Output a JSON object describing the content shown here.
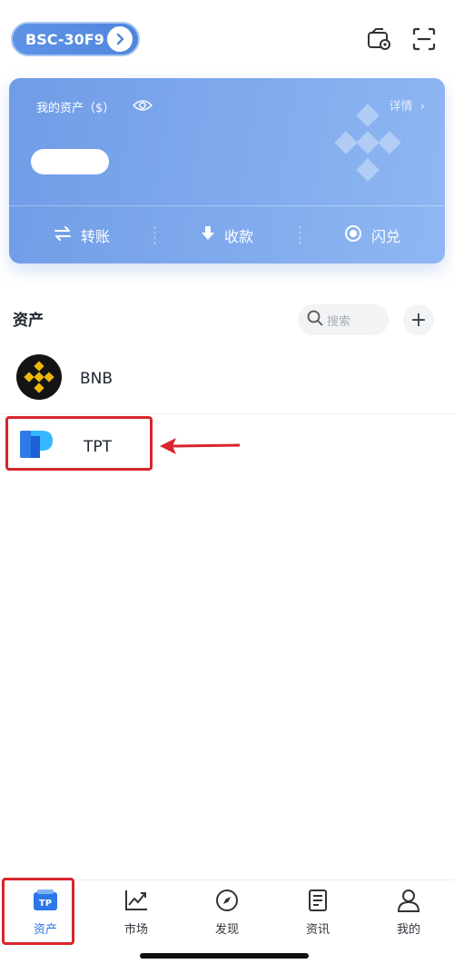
{
  "header": {
    "wallet_name": "BSC-30F9",
    "icons": [
      "wallet-camera-icon",
      "scan-icon"
    ]
  },
  "asset_card": {
    "title": "我的资产（$）",
    "detail_label": "详情",
    "actions": [
      {
        "label": "转账",
        "icon": "transfer-icon"
      },
      {
        "label": "收款",
        "icon": "receive-icon"
      },
      {
        "label": "闪兑",
        "icon": "swap-icon"
      }
    ]
  },
  "assets": {
    "section_title": "资产",
    "search_placeholder": "搜索",
    "add_label": "+",
    "tokens": [
      {
        "name": "BNB",
        "icon": "bnb-logo-icon"
      },
      {
        "name": "TPT",
        "icon": "tpt-logo-icon"
      }
    ]
  },
  "bottom_nav": {
    "items": [
      {
        "label": "资产",
        "icon": "wallet-tp-icon",
        "active": true
      },
      {
        "label": "市场",
        "icon": "chart-icon",
        "active": false
      },
      {
        "label": "发现",
        "icon": "compass-icon",
        "active": false
      },
      {
        "label": "资讯",
        "icon": "news-icon",
        "active": false
      },
      {
        "label": "我的",
        "icon": "user-icon",
        "active": false
      }
    ]
  },
  "colors": {
    "accent": "#2d76e8",
    "card_blue": "#7aa6ec",
    "highlight_red": "#d9252b",
    "bnb_yellow": "#f0b90b"
  }
}
